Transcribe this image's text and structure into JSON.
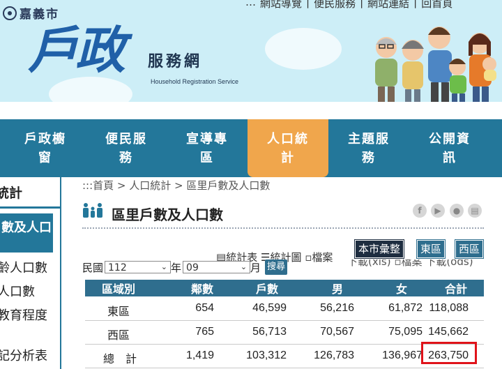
{
  "header": {
    "city_name": "嘉義市",
    "top_links": [
      "…",
      "網站導覽",
      "|",
      "便民服務",
      "|",
      "網站連結",
      "|",
      "回首頁"
    ],
    "brand_title": "戶政",
    "brand_subtitle": "服務網",
    "brand_english": "Household Registration Service"
  },
  "nav": {
    "items": [
      {
        "line1": "戶政櫥",
        "line2": "窗"
      },
      {
        "line1": "便民服",
        "line2": "務"
      },
      {
        "line1": "宣導專",
        "line2": "區"
      },
      {
        "line1": "人口統",
        "line2": "計"
      },
      {
        "line1": "主題服",
        "line2": "務"
      },
      {
        "line1": "公開資",
        "line2": "訊"
      }
    ]
  },
  "sidebar": {
    "title": "統計",
    "active": "數及人口",
    "links": [
      "齡人口數",
      "人口數",
      "教育程度",
      "記分析表"
    ]
  },
  "breadcrumb": ":::首頁 > 人口統計 > 區里戶數及人口數",
  "page_title": "區里戶數及人口數",
  "share_icons": [
    "facebook-icon",
    "play-icon",
    "line-icon",
    "print-icon"
  ],
  "area_buttons": [
    "本市彙整",
    "東區",
    "西區"
  ],
  "tools": {
    "table_label": "統計表",
    "chart_label": "統計圖",
    "file_label": "檔案",
    "download_label": "下載(xls)",
    "file2_label": "檔案",
    "download2_label": "下載(ods)"
  },
  "filter": {
    "year_label": "民國",
    "year_value": "112",
    "year_unit": "年",
    "month_value": "09",
    "month_unit": "月",
    "search_label": "搜尋"
  },
  "table": {
    "headers": [
      "區域別",
      "鄰數",
      "戶數",
      "男",
      "女",
      "合計"
    ],
    "rows": [
      [
        "東區",
        "654",
        "46,599",
        "56,216",
        "61,872",
        "118,088"
      ],
      [
        "西區",
        "765",
        "56,713",
        "70,567",
        "75,095",
        "145,662"
      ],
      [
        "總　計",
        "1,419",
        "103,312",
        "126,783",
        "136,967",
        "263,750"
      ]
    ]
  },
  "colors": {
    "nav_bg": "#23779a",
    "nav_active": "#f0a64c",
    "table_header": "#2f6e8e",
    "highlight": "#e0131a"
  }
}
